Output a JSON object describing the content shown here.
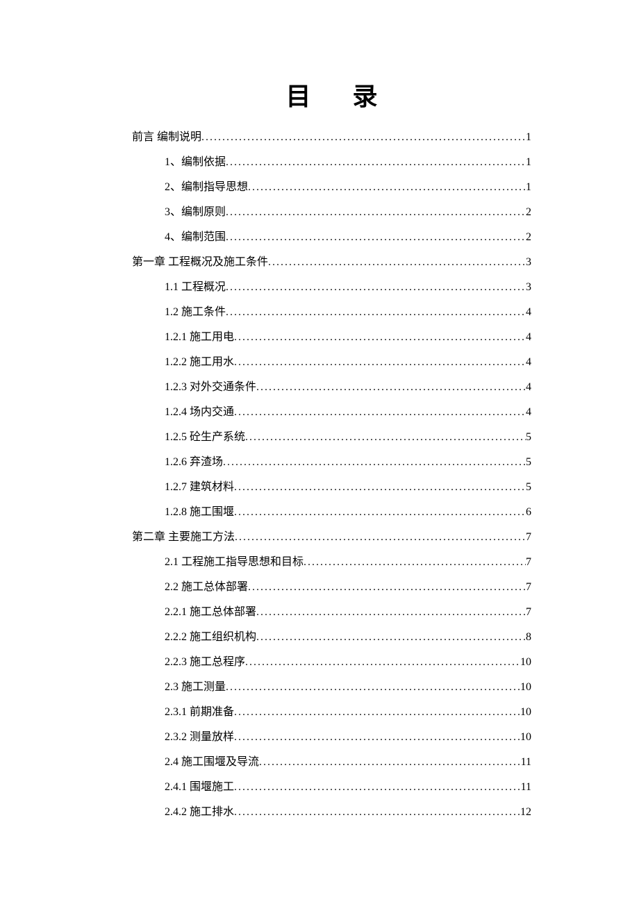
{
  "title": "目录",
  "toc": [
    {
      "level": 0,
      "label": "前言   编制说明",
      "page": "1"
    },
    {
      "level": 1,
      "label": "1、编制依据",
      "page": "1"
    },
    {
      "level": 1,
      "label": "2、编制指导思想",
      "page": "1"
    },
    {
      "level": 1,
      "label": "3、编制原则",
      "page": "2"
    },
    {
      "level": 1,
      "label": "4、编制范围",
      "page": "2"
    },
    {
      "level": 0,
      "label": "第一章  工程概况及施工条件",
      "page": "3"
    },
    {
      "level": 1,
      "label": "1.1 工程概况",
      "page": "3"
    },
    {
      "level": 1,
      "label": "1.2 施工条件",
      "page": "4"
    },
    {
      "level": 1,
      "label": "1.2.1 施工用电",
      "page": "4"
    },
    {
      "level": 1,
      "label": "1.2.2 施工用水",
      "page": "4"
    },
    {
      "level": 1,
      "label": "1.2.3 对外交通条件",
      "page": "4"
    },
    {
      "level": 1,
      "label": "1.2.4 场内交通",
      "page": "4"
    },
    {
      "level": 1,
      "label": "1.2.5 砼生产系统",
      "page": "5"
    },
    {
      "level": 1,
      "label": "1.2.6 弃渣场",
      "page": "5"
    },
    {
      "level": 1,
      "label": "1.2.7 建筑材料",
      "page": "5"
    },
    {
      "level": 1,
      "label": "1.2.8 施工围堰",
      "page": "6"
    },
    {
      "level": 0,
      "label": "第二章 主要施工方法",
      "page": "7"
    },
    {
      "level": 1,
      "label": "2.1 工程施工指导思想和目标 ",
      "page": "7"
    },
    {
      "level": 1,
      "label": "2.2 施工总体部署",
      "page": "7"
    },
    {
      "level": 1,
      "label": "2.2.1 施工总体部署",
      "page": "7"
    },
    {
      "level": 1,
      "label": "2.2.2 施工组织机构",
      "page": "8"
    },
    {
      "level": 1,
      "label": "2.2.3 施工总程序",
      "page": "10"
    },
    {
      "level": 1,
      "label": "2.3 施工测量",
      "page": "10"
    },
    {
      "level": 1,
      "label": "2.3.1 前期准备",
      "page": "10"
    },
    {
      "level": 1,
      "label": "2.3.2 测量放样",
      "page": "10"
    },
    {
      "level": 1,
      "label": "2.4 施工围堰及导流 ",
      "page": " 11"
    },
    {
      "level": 1,
      "label": "2.4.1 围堰施工",
      "page": "11"
    },
    {
      "level": 1,
      "label": "2.4.2 施工排水",
      "page": "12"
    }
  ]
}
